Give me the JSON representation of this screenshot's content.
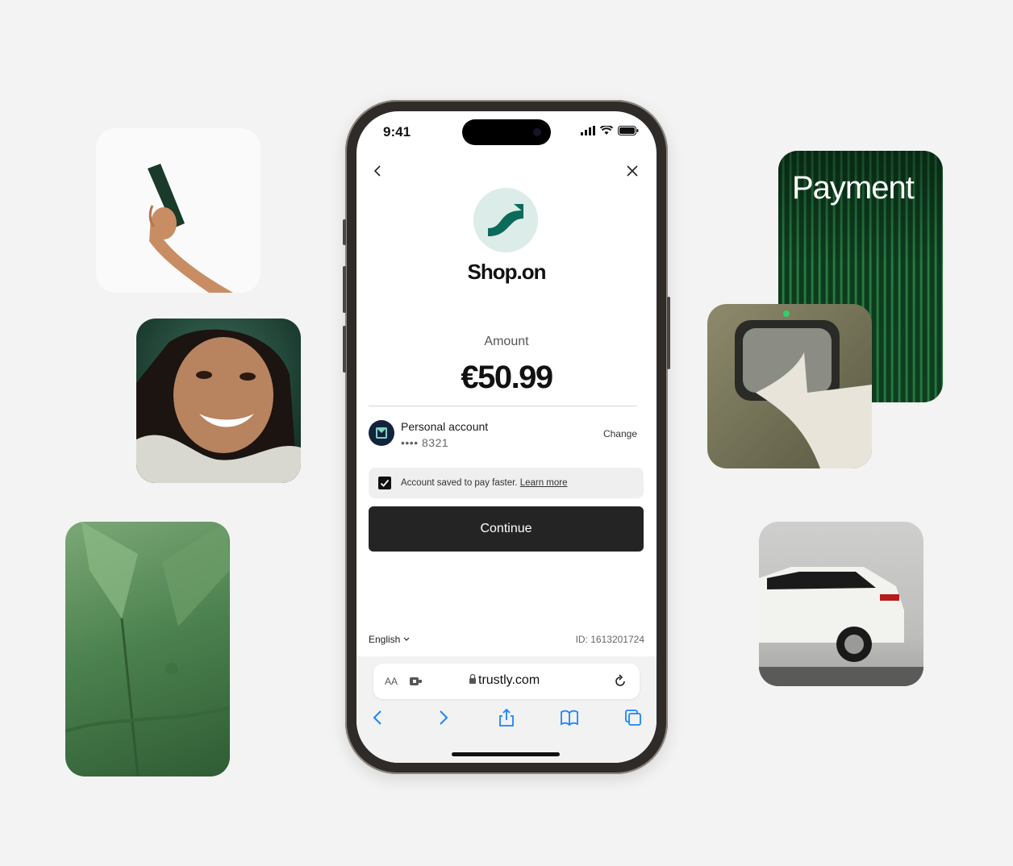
{
  "status_bar": {
    "time": "9:41"
  },
  "merchant": {
    "name": "Shop.on"
  },
  "amount": {
    "label": "Amount",
    "value": "€50.99"
  },
  "account": {
    "name": "Personal account",
    "masked_number": "•••• 8321",
    "change_label": "Change"
  },
  "saved_notice": {
    "text": "Account saved to pay faster.",
    "link": "Learn more",
    "checked": true
  },
  "continue_label": "Continue",
  "footer": {
    "language": "English",
    "id_text": "ID: 1613201724"
  },
  "browser": {
    "aa_label": "AA",
    "url": "trustly.com"
  },
  "tiles": {
    "payment_word": "Payment"
  },
  "colors": {
    "brand_green": "#0b6b5a",
    "button_dark": "#242424",
    "ios_blue": "#1a84ff"
  }
}
